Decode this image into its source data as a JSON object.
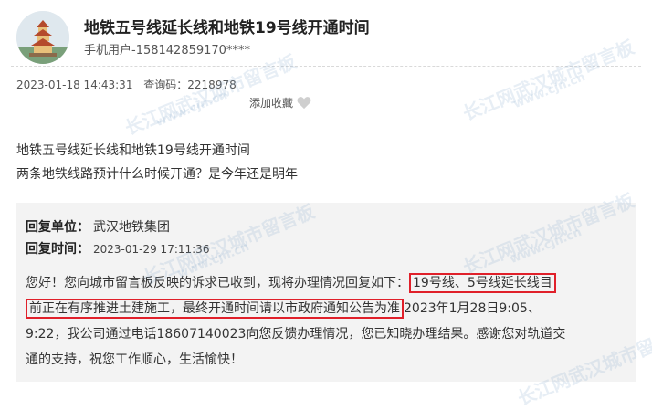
{
  "header": {
    "title": "地铁五号线延长线和地铁19号线开通时间",
    "user": "手机用户-158142859170****"
  },
  "meta": {
    "datetime": "2023-01-18 14:43:31",
    "query_code": "查询码：2218978",
    "favorite_label": "添加收藏"
  },
  "post": {
    "line1": "地铁五号线延长线和地铁19号线开通时间",
    "line2": "两条地铁线路预计什么时候开通？是今年还是明年"
  },
  "reply": {
    "unit_label": "回复单位：",
    "unit_value": "武汉地铁集团",
    "time_label": "回复时间：",
    "time_value": "2023-01-29 17:11:36",
    "p1": "您好！您向城市留言板反映的诉求已收到，现将办理情况回复如下：",
    "p1_hl": "19号线、5号线延长线目",
    "p2_hl": "前正在有序推进土建施工，最终开通时间请以市政府通知公告为准",
    "p2": "2023年1月28日9:05、",
    "p3": "9:22，我公司通过电话18607140023向您反馈办理情况，您已知晓办理结果。感谢您对轨道交",
    "p4": "通的支持，祝您工作顺心，生活愉快！"
  },
  "watermark": {
    "text": "长江网武汉城市留言板",
    "url": "www.cjn.cn"
  },
  "colors": {
    "highlight": "#e0202a",
    "reply_bg": "#f3f3f3"
  }
}
